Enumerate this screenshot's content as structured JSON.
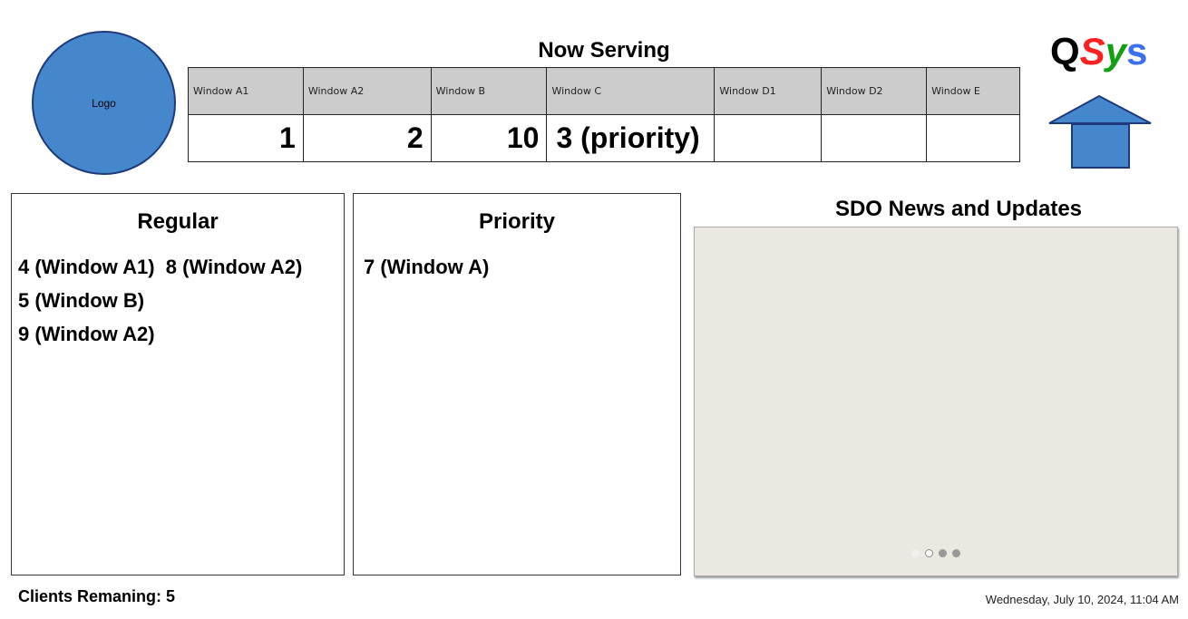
{
  "logo": {
    "label": "Logo"
  },
  "now_serving": {
    "title": "Now Serving",
    "columns": [
      "Window A1",
      "Window A2",
      "Window B",
      "Window C",
      "Window D1",
      "Window D2",
      "Window E"
    ],
    "values": [
      "1",
      "2",
      "10",
      "3 (priority)",
      "",
      "",
      ""
    ]
  },
  "brand": {
    "q": "Q",
    "s": "S",
    "y": "y",
    "s2": "s",
    "colors": {
      "q": "#000000",
      "s": "#ff2020",
      "y": "#10a010",
      "s2": "#3a6ff0"
    }
  },
  "regular": {
    "title": "Regular",
    "entries": [
      "4 (Window A1)",
      "8 (Window A2)",
      "5 (Window B)",
      "9 (Window A2)"
    ]
  },
  "priority": {
    "title": "Priority",
    "entries": [
      "7 (Window A)"
    ]
  },
  "news": {
    "title": "SDO News and Updates",
    "slides": 3,
    "active_slide": 1
  },
  "footer": {
    "clients_remaining": "Clients Remaning: 5",
    "datetime": "Wednesday, July 10, 2024, 11:04 AM"
  }
}
